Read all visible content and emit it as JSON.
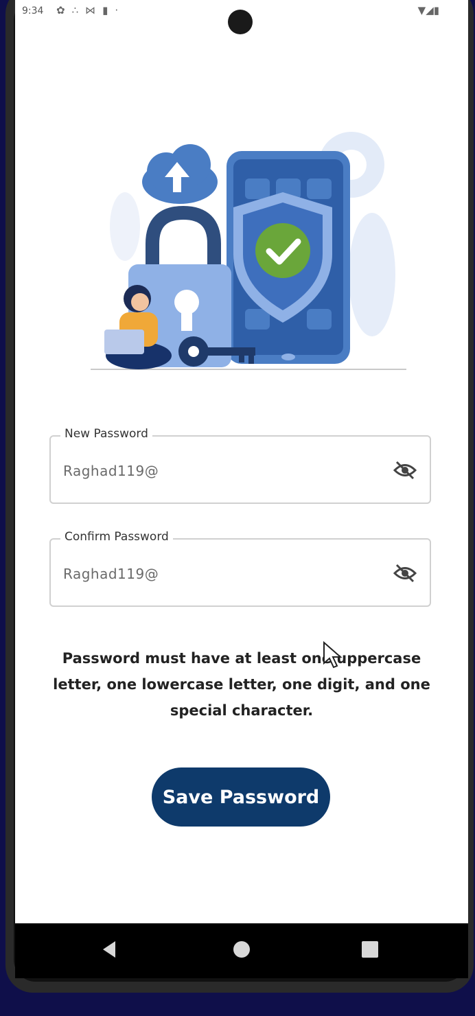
{
  "status": {
    "time": "9:34",
    "left_icons": [
      "gear-icon",
      "share-icon",
      "mail-icon",
      "battery-saver-icon",
      "dot-icon"
    ],
    "right_icons": [
      "wifi-icon",
      "signal-icon",
      "battery-icon"
    ]
  },
  "form": {
    "new_password": {
      "label": "New Password",
      "value": "Raghad119@",
      "toggle_icon": "eye-off-icon"
    },
    "confirm_password": {
      "label": "Confirm Password",
      "value": "Raghad119@",
      "toggle_icon": "eye-off-icon"
    }
  },
  "hint": "Password must have at least one uppercase letter, one lowercase letter, one digit, and one special character.",
  "save_button": "Save Password",
  "colors": {
    "primary": "#0e3a6b",
    "illustration_blue": "#6f9be0",
    "check_green": "#6aa63a",
    "background": "#ffffff"
  },
  "navbar": [
    "back-icon",
    "home-icon",
    "recents-icon"
  ]
}
